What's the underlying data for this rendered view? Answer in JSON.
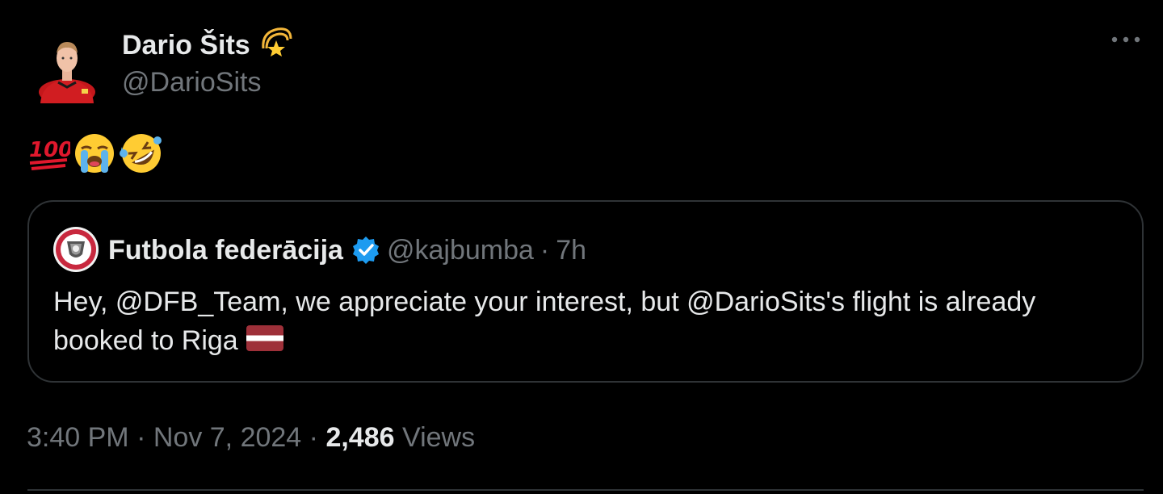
{
  "author": {
    "display_name": "Dario Šits",
    "handle": "@DarioSits",
    "name_emoji": "dizzy-emoji"
  },
  "tweet": {
    "emojis": [
      "hundred-points-emoji",
      "loudly-crying-face-emoji",
      "rolling-on-floor-laughing-emoji"
    ]
  },
  "quote": {
    "display_name": "Futbola federācija",
    "verified": true,
    "handle": "@kajbumba",
    "separator": "·",
    "time": "7h",
    "text": "Hey, @DFB_Team, we appreciate your interest, but @DarioSits's flight is already booked to Riga",
    "text_emoji": "latvia-flag-emoji"
  },
  "meta": {
    "time": "3:40 PM",
    "sep1": "·",
    "date": "Nov 7, 2024",
    "sep2": "·",
    "views_count": "2,486",
    "views_label": "Views"
  },
  "colors": {
    "background": "#000000",
    "text": "#e7e9ea",
    "muted": "#71767b",
    "border": "#2f3336",
    "verified_blue": "#1d9bf0",
    "latvia_carmine": "#9e3039"
  }
}
